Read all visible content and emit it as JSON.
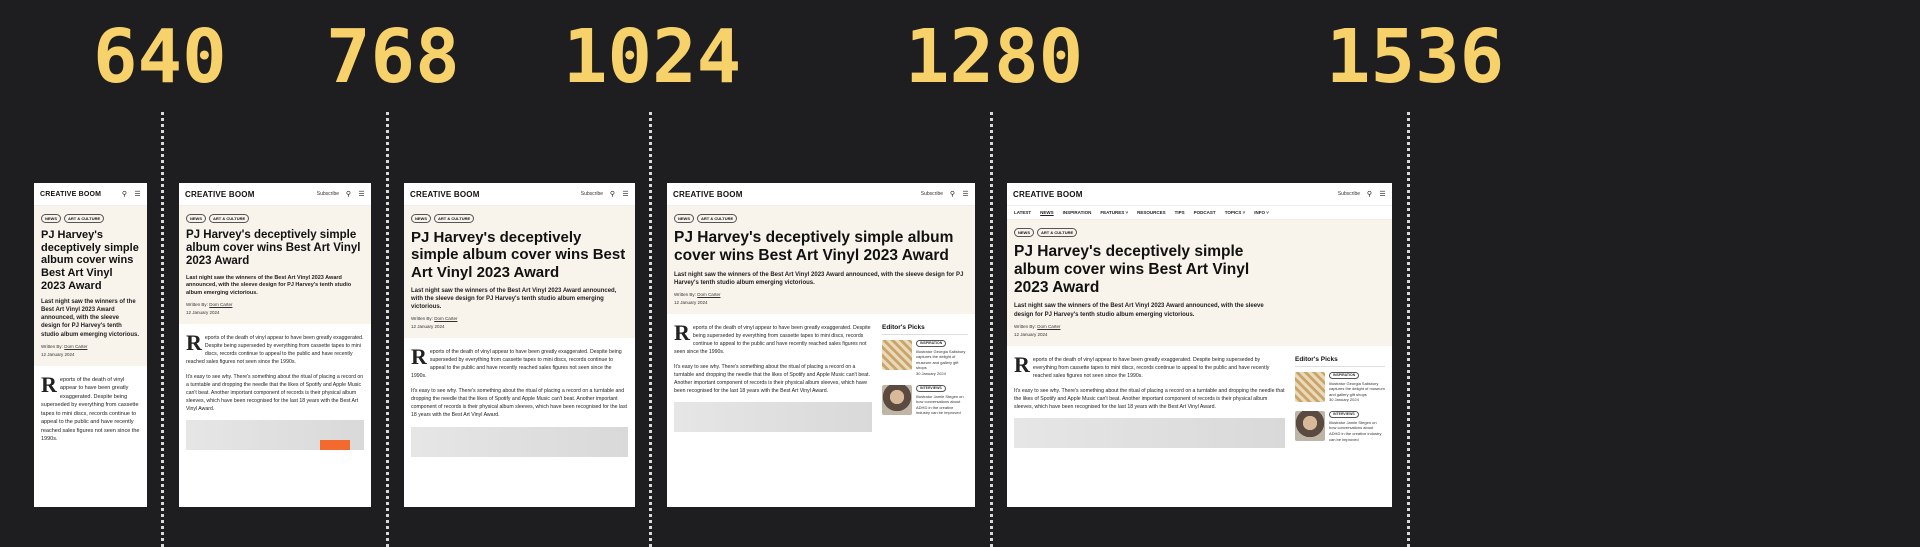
{
  "breakpoints": [
    "640",
    "768",
    "1024",
    "1280",
    "1536"
  ],
  "site": {
    "logo": "CREATIVE BOOM",
    "subscribe": "Subscribe"
  },
  "menu": [
    "LATEST",
    "NEWS",
    "INSPIRATION",
    "FEATURES ˅",
    "RESOURCES",
    "TIPS",
    "PODCAST",
    "TOPICS ˅",
    "INFO ˅"
  ],
  "tags": [
    "NEWS",
    "ART & CULTURE"
  ],
  "article": {
    "title": "PJ Harvey's deceptively simple album cover wins Best Art Vinyl 2023 Award",
    "subtitle": "Last night saw the winners of the Best Art Vinyl 2023 Award announced, with the sleeve design for PJ Harvey's tenth studio album emerging victorious.",
    "written_by": "Written By:",
    "author": "Dom Carter",
    "date": "12 January 2024",
    "drop_cap": "R",
    "p1": "eports of the death of vinyl appear to have been greatly exaggerated. Despite being superseded by everything from cassette tapes to mini discs, records continue to appeal to the public and have recently reached sales figures not seen since the 1990s.",
    "p2": "It's easy to see why. There's something about the ritual of placing a record on a turntable and dropping the needle that the likes of Spotify and Apple Music can't beat. Another important component of records is their physical album sleeves, which have been recognised for the last 18 years with the Best Art Vinyl Award."
  },
  "editors_picks": {
    "heading": "Editor's Picks",
    "items": [
      {
        "tag": "INSPIRATION",
        "text": "Illustrator Georgia Salisbury captures the delight of museum and gallery gift shops",
        "date": "30 January 2024"
      },
      {
        "tag": "INTERVIEWS",
        "text": "Illustrator Jamie Stegen on how conversations about ADHD in the creative industry can be improved",
        "date": ""
      }
    ]
  },
  "icons": {
    "search": "search-icon",
    "menu": "hamburger-menu-icon"
  },
  "colors": {
    "background": "#1e1e21",
    "label": "#f7d16a",
    "hero": "#f8f4ec"
  }
}
